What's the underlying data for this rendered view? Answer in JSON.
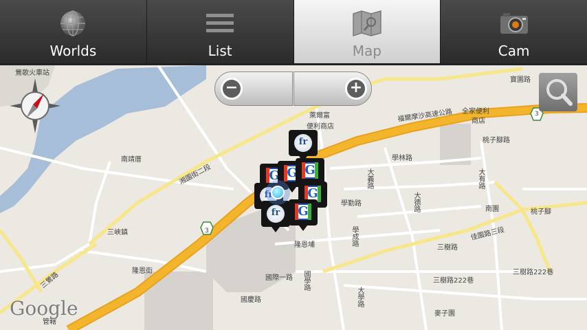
{
  "tabs": [
    {
      "label": "Worlds",
      "icon": "globe-icon",
      "active": false
    },
    {
      "label": "List",
      "icon": "list-icon",
      "active": false
    },
    {
      "label": "Map",
      "icon": "map-icon",
      "active": true
    },
    {
      "label": "Cam",
      "icon": "camera-icon",
      "active": false
    }
  ],
  "map": {
    "labels": {
      "station": "鶯歌火車站",
      "nanjing": "南靖厝",
      "xiangyuan": "湘園街二段",
      "freeway": "福爾摩沙高速公路",
      "shop1a": "萊爾富",
      "shop1b": "便利商店",
      "shop2a": "全家便利",
      "shop2b": "商店",
      "baoyuan": "寶園路",
      "taozi_jiao": "桃子腳路",
      "xuelin": "學林路",
      "daxue_rd": "大義路",
      "xueqin": "學勤路",
      "dayou": "大有路",
      "dade": "大德路",
      "xuecheng": "學成路",
      "nanyuan": "南園",
      "taozi": "桃子腳",
      "jiayuan": "佳園路三段",
      "sanshu": "三樹路",
      "sanshu222a": "三樹路222巷",
      "sanshu222b": "三樹路222巷",
      "sanxia": "三峽鎮",
      "longen_st": "隆恩街",
      "longen_bu": "隆恩埔",
      "guoji": "國際一路",
      "guoxue": "國學路",
      "guoqing": "國慶路",
      "sanying": "三鶯路",
      "daxue_v": "大學路",
      "maizi": "麥子園",
      "route": "3",
      "guanzhou": "管轄"
    },
    "attribution": "Google"
  },
  "controls": {
    "zoom_out": "−",
    "zoom_in": "+"
  },
  "colors": {
    "river": "#a7bed9",
    "land": "#ece8e2",
    "highway": "#f3b52c",
    "road": "#ffffff",
    "minor_road": "#f8e68a",
    "block": "#d6d3cf",
    "active_tab": "#e4e4e4"
  }
}
